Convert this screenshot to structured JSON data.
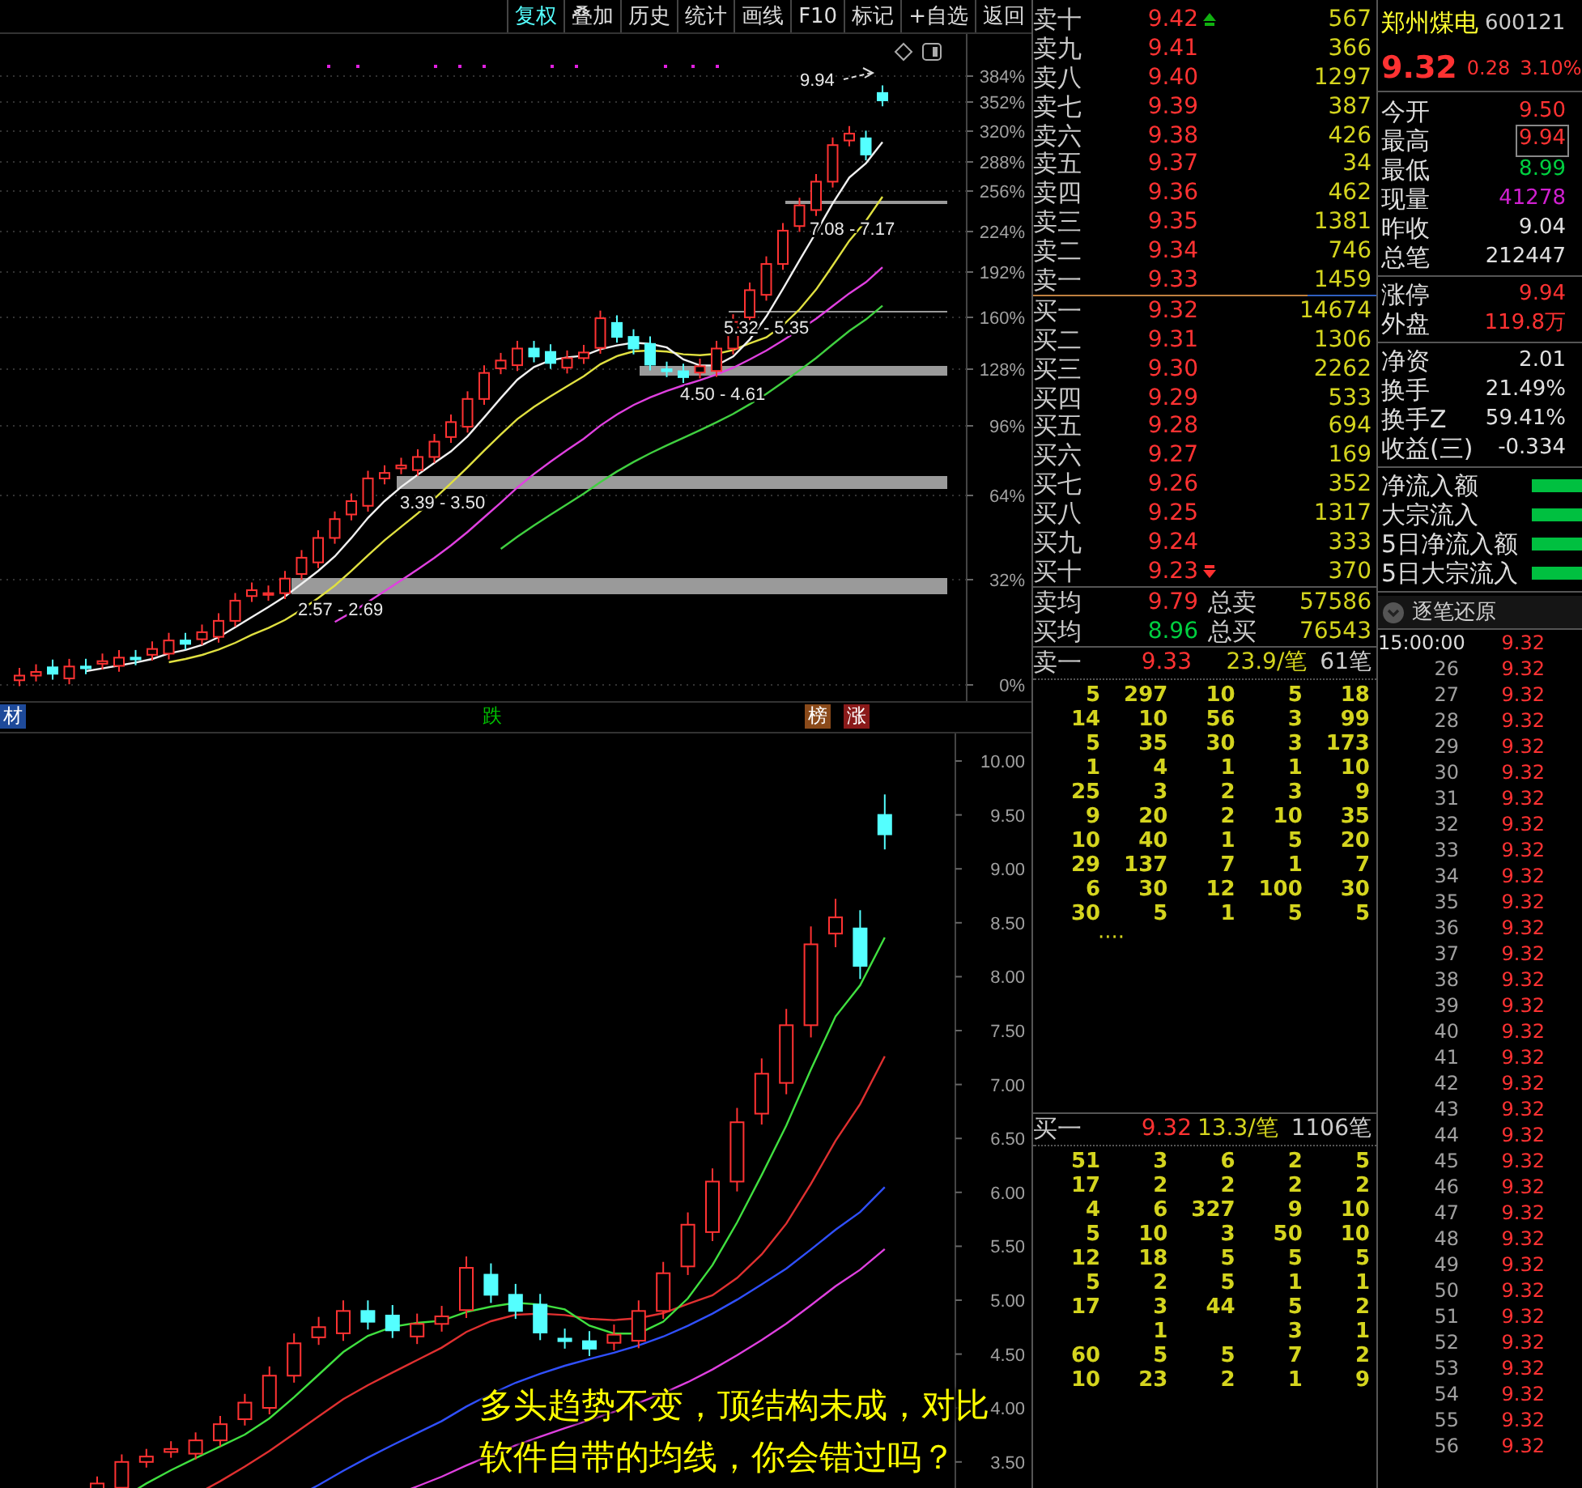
{
  "toolbar": [
    {
      "label": "复权",
      "selected": true
    },
    {
      "label": "叠加",
      "selected": false
    },
    {
      "label": "历史",
      "selected": false
    },
    {
      "label": "统计",
      "selected": false
    },
    {
      "label": "画线",
      "selected": false
    },
    {
      "label": "F10",
      "selected": false
    },
    {
      "label": "标记",
      "selected": false
    },
    {
      "label": "+自选",
      "selected": false
    },
    {
      "label": "返回",
      "selected": false
    }
  ],
  "top_chart": {
    "axis_labels": [
      "384%",
      "352%",
      "320%",
      "288%",
      "256%",
      "224%",
      "192%",
      "160%",
      "128%",
      "96%",
      "64%",
      "32%",
      "0%"
    ],
    "high_label": "9.94",
    "zones": [
      {
        "label": "7.08 - 7.17"
      },
      {
        "label": "5.32 - 5.35"
      },
      {
        "label": "4.50 - 4.61"
      },
      {
        "label": "3.39 - 3.50"
      },
      {
        "label": "2.57 - 2.69"
      }
    ]
  },
  "markers": [
    {
      "text": "材",
      "kind": "badge",
      "color": "#1e4a9a"
    },
    {
      "text": "跌",
      "kind": "plain",
      "color": "#00c000"
    },
    {
      "text": "榜",
      "kind": "badge",
      "color": "#8a4a1a"
    },
    {
      "text": "涨",
      "kind": "badge",
      "color": "#8a1a1a"
    }
  ],
  "bottom_chart": {
    "axis_labels": [
      "10.00",
      "9.50",
      "9.00",
      "8.50",
      "8.00",
      "7.50",
      "7.00",
      "6.50",
      "6.00",
      "5.50",
      "5.00",
      "4.50",
      "4.00",
      "3.50"
    ]
  },
  "caption": [
    "多头趋势不变，顶结构未成，对比",
    "软件自带的均线，你会错过吗？"
  ],
  "order_book": {
    "asks": [
      {
        "label": "卖十",
        "price": "9.42",
        "volume": "567",
        "kind": "up_mark"
      },
      {
        "label": "卖九",
        "price": "9.41",
        "volume": "366",
        "kind": "plain"
      },
      {
        "label": "卖八",
        "price": "9.40",
        "volume": "1297",
        "kind": "plain"
      },
      {
        "label": "卖七",
        "price": "9.39",
        "volume": "387",
        "kind": "plain"
      },
      {
        "label": "卖六",
        "price": "9.38",
        "volume": "426",
        "kind": "plain"
      },
      {
        "label": "卖五",
        "price": "9.37",
        "volume": "34",
        "kind": "plain"
      },
      {
        "label": "卖四",
        "price": "9.36",
        "volume": "462",
        "kind": "plain"
      },
      {
        "label": "卖三",
        "price": "9.35",
        "volume": "1381",
        "kind": "plain"
      },
      {
        "label": "卖二",
        "price": "9.34",
        "volume": "746",
        "kind": "plain"
      },
      {
        "label": "卖一",
        "price": "9.33",
        "volume": "1459",
        "kind": "plain"
      }
    ],
    "bids": [
      {
        "label": "买一",
        "price": "9.32",
        "volume": "14674",
        "kind": "plain"
      },
      {
        "label": "买二",
        "price": "9.31",
        "volume": "1306",
        "kind": "plain"
      },
      {
        "label": "买三",
        "price": "9.30",
        "volume": "2262",
        "kind": "plain"
      },
      {
        "label": "买四",
        "price": "9.29",
        "volume": "533",
        "kind": "plain"
      },
      {
        "label": "买五",
        "price": "9.28",
        "volume": "694",
        "kind": "plain"
      },
      {
        "label": "买六",
        "price": "9.27",
        "volume": "169",
        "kind": "plain"
      },
      {
        "label": "买七",
        "price": "9.26",
        "volume": "352",
        "kind": "plain"
      },
      {
        "label": "买八",
        "price": "9.25",
        "volume": "1317",
        "kind": "plain"
      },
      {
        "label": "买九",
        "price": "9.24",
        "volume": "333",
        "kind": "plain"
      },
      {
        "label": "买十",
        "price": "9.23",
        "volume": "370",
        "kind": "down_mark"
      }
    ],
    "averages": [
      {
        "label": "卖均",
        "price": "9.79",
        "total_label": "总卖",
        "total": "57586"
      },
      {
        "label": "买均",
        "price": "8.96",
        "total_label": "总买",
        "total": "76543"
      }
    ]
  },
  "ask_queue": {
    "label": "卖一",
    "price": "9.33",
    "avg": "23.9/笔",
    "count": "61笔",
    "more": "····",
    "rows": [
      [
        "5",
        "297",
        "10",
        "5",
        "18"
      ],
      [
        "14",
        "10",
        "56",
        "3",
        "99"
      ],
      [
        "5",
        "35",
        "30",
        "3",
        "173"
      ],
      [
        "1",
        "4",
        "1",
        "1",
        "10"
      ],
      [
        "25",
        "3",
        "2",
        "3",
        "9"
      ],
      [
        "9",
        "20",
        "2",
        "10",
        "35"
      ],
      [
        "10",
        "40",
        "1",
        "5",
        "20"
      ],
      [
        "29",
        "137",
        "7",
        "1",
        "7"
      ],
      [
        "6",
        "30",
        "12",
        "100",
        "30"
      ],
      [
        "30",
        "5",
        "1",
        "5",
        "5"
      ]
    ]
  },
  "bid_queue": {
    "label": "买一",
    "price": "9.32",
    "avg": "13.3/笔",
    "count": "1106笔",
    "rows": [
      [
        "51",
        "3",
        "6",
        "2",
        "5"
      ],
      [
        "17",
        "2",
        "2",
        "2",
        "2"
      ],
      [
        "4",
        "6",
        "327",
        "9",
        "10"
      ],
      [
        "5",
        "10",
        "3",
        "50",
        "10"
      ],
      [
        "12",
        "18",
        "5",
        "5",
        "5"
      ],
      [
        "5",
        "2",
        "5",
        "1",
        "1"
      ],
      [
        "17",
        "3",
        "44",
        "5",
        "2"
      ],
      [
        null,
        "1",
        null,
        "3",
        "1"
      ],
      [
        "60",
        "5",
        "5",
        "7",
        "2"
      ],
      [
        "10",
        "23",
        "2",
        "1",
        "9"
      ]
    ]
  },
  "quote": {
    "name": "郑州煤电",
    "code": "600121",
    "price": "9.32",
    "change": "0.28",
    "change_pct": "3.10%"
  },
  "stats_groups": [
    [
      {
        "label": "今开",
        "value": "9.50",
        "kind": "price",
        "boxed": false
      },
      {
        "label": "最高",
        "value": "9.94",
        "kind": "price",
        "boxed": true
      },
      {
        "label": "最低",
        "value": "8.99",
        "kind": "price",
        "boxed": false
      },
      {
        "label": "现量",
        "value": "41278",
        "kind": "volume",
        "boxed": false
      },
      {
        "label": "昨收",
        "value": "9.04",
        "kind": "prev_close",
        "boxed": false
      },
      {
        "label": "总笔",
        "value": "212447",
        "kind": "plain",
        "boxed": false
      }
    ],
    [
      {
        "label": "涨停",
        "value": "9.94",
        "kind": "price",
        "boxed": false
      },
      {
        "label": "外盘",
        "value": "119.8万",
        "kind": "inflow",
        "boxed": false
      }
    ],
    [
      {
        "label": "净资",
        "value": "2.01",
        "kind": "plain",
        "boxed": false
      },
      {
        "label": "换手",
        "value": "21.49%",
        "kind": "plain",
        "boxed": false
      },
      {
        "label": "换手Z",
        "value": "59.41%",
        "kind": "plain",
        "boxed": false
      },
      {
        "label": "收益(三)",
        "value": "-0.334",
        "kind": "plain",
        "boxed": false
      }
    ]
  ],
  "flows": [
    {
      "label": "净流入额"
    },
    {
      "label": "大宗流入"
    },
    {
      "label": "5日净流入额"
    },
    {
      "label": "5日大宗流入"
    }
  ],
  "tick_toggle": {
    "label": "逐笔还原"
  },
  "ticks": [
    {
      "time": "15:00:00",
      "price": "9.32"
    },
    {
      "time": "26",
      "price": "9.32"
    },
    {
      "time": "27",
      "price": "9.32"
    },
    {
      "time": "28",
      "price": "9.32"
    },
    {
      "time": "29",
      "price": "9.32"
    },
    {
      "time": "30",
      "price": "9.32"
    },
    {
      "time": "31",
      "price": "9.32"
    },
    {
      "time": "32",
      "price": "9.32"
    },
    {
      "time": "33",
      "price": "9.32"
    },
    {
      "time": "34",
      "price": "9.32"
    },
    {
      "time": "35",
      "price": "9.32"
    },
    {
      "time": "36",
      "price": "9.32"
    },
    {
      "time": "37",
      "price": "9.32"
    },
    {
      "time": "38",
      "price": "9.32"
    },
    {
      "time": "39",
      "price": "9.32"
    },
    {
      "time": "40",
      "price": "9.32"
    },
    {
      "time": "41",
      "price": "9.32"
    },
    {
      "time": "42",
      "price": "9.32"
    },
    {
      "time": "43",
      "price": "9.32"
    },
    {
      "time": "44",
      "price": "9.32"
    },
    {
      "time": "45",
      "price": "9.32"
    },
    {
      "time": "46",
      "price": "9.32"
    },
    {
      "time": "47",
      "price": "9.32"
    },
    {
      "time": "48",
      "price": "9.32"
    },
    {
      "time": "49",
      "price": "9.32"
    },
    {
      "time": "50",
      "price": "9.32"
    },
    {
      "time": "51",
      "price": "9.32"
    },
    {
      "time": "52",
      "price": "9.32"
    },
    {
      "time": "53",
      "price": "9.32"
    },
    {
      "time": "54",
      "price": "9.32"
    },
    {
      "time": "55",
      "price": "9.32"
    },
    {
      "time": "56",
      "price": "9.32"
    }
  ]
}
